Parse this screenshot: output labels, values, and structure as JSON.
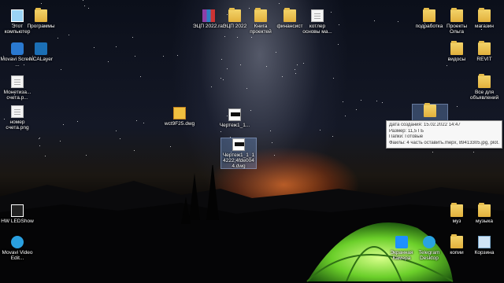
{
  "desktop": {
    "icons": [
      {
        "id": "this-pc",
        "label": "Этот компьютер",
        "kind": "pc"
      },
      {
        "id": "programs",
        "label": "Программы",
        "kind": "folder"
      },
      {
        "id": "movavi-screen",
        "label": "Movavi Screen ...",
        "kind": "app"
      },
      {
        "id": "ncalayer",
        "label": "NCALayer",
        "kind": "app"
      },
      {
        "id": "monetization",
        "label": "Монетиза... счета.p...",
        "kind": "doc"
      },
      {
        "id": "invoice-number",
        "label": "номер счета.png",
        "kind": "doc"
      },
      {
        "id": "ecp-rar",
        "label": "ЭЦП 2022.rar",
        "kind": "archive"
      },
      {
        "id": "ecp-folder",
        "label": "ЭЦП 2022",
        "kind": "folder"
      },
      {
        "id": "books",
        "label": "Книга проектей",
        "kind": "folder"
      },
      {
        "id": "finance",
        "label": "финансист",
        "kind": "folder"
      },
      {
        "id": "boiler",
        "label": "котлер основы ма...",
        "kind": "doc"
      },
      {
        "id": "work-subdir",
        "label": "подработка",
        "kind": "folder"
      },
      {
        "id": "projects-olga",
        "label": "Проекты Ольга",
        "kind": "folder"
      },
      {
        "id": "shop",
        "label": "магазин",
        "kind": "folder"
      },
      {
        "id": "videos",
        "label": "видосы",
        "kind": "folder"
      },
      {
        "id": "revit",
        "label": "REVIT",
        "kind": "folder"
      },
      {
        "id": "ads",
        "label": "Все для объявлений",
        "kind": "folder"
      },
      {
        "id": "wct-dwg",
        "label": "wct9F25.dwg",
        "kind": "dwg"
      },
      {
        "id": "drawing-1",
        "label": "Чертеж1_1...",
        "kind": "dwg"
      },
      {
        "id": "drawing-2",
        "label": "Чертеж1_1_1 4222;4fde004 4.dwg",
        "kind": "dwg"
      },
      {
        "id": "ready",
        "label": "",
        "kind": "folder"
      },
      {
        "id": "hw-ledshow",
        "label": "HW LEDShow",
        "kind": "app"
      },
      {
        "id": "movavi-video",
        "label": "Movavi Video Edit...",
        "kind": "app"
      },
      {
        "id": "screen-camera",
        "label": "Экранная Камера",
        "kind": "app"
      },
      {
        "id": "telegram",
        "label": "Telegram Desktop",
        "kind": "app"
      },
      {
        "id": "music-1",
        "label": "муз",
        "kind": "folder"
      },
      {
        "id": "music-2",
        "label": "музыка",
        "kind": "folder"
      },
      {
        "id": "copies",
        "label": "копии",
        "kind": "folder"
      },
      {
        "id": "recycle",
        "label": "Корзина",
        "kind": "recycle"
      }
    ]
  },
  "tooltip": {
    "created": "Дата создания: 15.02.2022 14:47",
    "size": "Размер: 11,5 ГБ",
    "folders": "Папки: Готовые",
    "files": "Файлы: 4 часть оставить.mepx, 89413305.jpg, plot.log, ..."
  }
}
